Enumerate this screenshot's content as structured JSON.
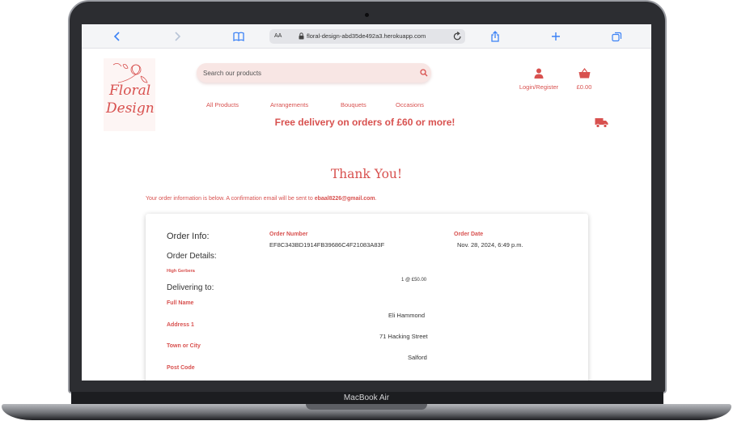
{
  "device": {
    "label": "MacBook Air"
  },
  "browser": {
    "text_size_label": "AA",
    "url": "floral-design-abd35de492a3.herokuapp.com",
    "icons": [
      "back-icon",
      "forward-icon",
      "bookmarks-icon",
      "lock-icon",
      "reload-icon",
      "share-icon",
      "new-tab-icon",
      "tabs-icon"
    ]
  },
  "site": {
    "logo_line1": "Floral",
    "logo_line2": "Design",
    "search_placeholder": "Search our products",
    "account_label": "Login/Register",
    "cart_total": "£0.00",
    "nav": [
      "All Products",
      "Arrangements",
      "Bouquets",
      "Occasions"
    ],
    "promo": "Free delivery on orders of £60 or more!",
    "accent_color": "#d8514f"
  },
  "confirmation": {
    "title": "Thank You!",
    "info_text": "Your order information is below. A confirmation email will be sent to ",
    "email": "ebaal8226@gmail.com",
    "info_end": ".",
    "order_info_heading": "Order Info:",
    "order_number_label": "Order Number",
    "order_number": "EF8C343BD1914FB39686C4F21083A83F",
    "order_date_label": "Order Date",
    "order_date": "Nov. 28, 2024, 6:49 p.m.",
    "order_details_heading": "Order Details:",
    "item_name": "High Gerbera",
    "item_qty_price": "1 @ £50.00",
    "delivering_heading": "Delivering to:",
    "full_name_label": "Full Name",
    "full_name": "Eli Hammond",
    "address1_label": "Address 1",
    "address1": "71 Hacking Street",
    "town_label": "Town or City",
    "town": "Salford",
    "postcode_label": "Post Code"
  }
}
